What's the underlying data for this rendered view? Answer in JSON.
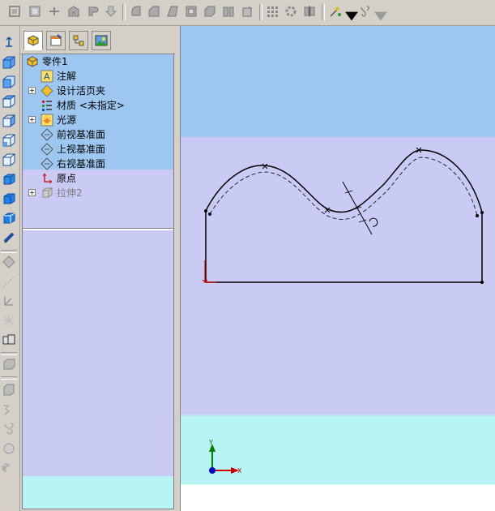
{
  "toolbar": {
    "icons": [
      "sketch-icon",
      "smart-dimension-icon",
      "revolve-icon",
      "sweep-icon",
      "loft-icon",
      "rib-icon",
      "fillet-icon",
      "chamfer-icon",
      "draft-icon",
      "shell-icon",
      "dome-icon",
      "wrap-icon",
      "mirror-icon",
      "linear-pattern-icon",
      "circular-pattern-icon",
      "mirror-feature-icon",
      "reference-geometry-icon",
      "curves-icon"
    ]
  },
  "left_toolbar": {
    "icons": [
      "normal-to-icon",
      "isometric-view-icon",
      "front-view-icon",
      "top-view-icon",
      "right-view-icon",
      "back-view-icon",
      "bottom-view-icon",
      "wireframe-icon",
      "shaded-icon",
      "shaded-edges-icon",
      "section-view-icon",
      "line-icon",
      "point-icon",
      "plane-icon",
      "axis-icon",
      "coordinate-icon",
      "extrude-icon",
      "cut-icon",
      "sweep-cut-icon",
      "loft-cut-icon",
      "helix-icon"
    ]
  },
  "feature_manager": {
    "tabs": [
      "feature-tree-tab",
      "property-manager-tab",
      "configuration-manager-tab",
      "display-manager-tab"
    ],
    "tree": {
      "root": {
        "label": "零件1"
      },
      "items": [
        {
          "label": "注解",
          "icon": "annotation-icon",
          "expandable": false
        },
        {
          "label": "设计活页夹",
          "icon": "design-binder-icon",
          "expandable": true
        },
        {
          "label": "材质 <未指定>",
          "icon": "material-icon",
          "expandable": false
        },
        {
          "label": "光源",
          "icon": "lights-icon",
          "expandable": true
        },
        {
          "label": "前视基准面",
          "icon": "plane-icon",
          "expandable": false
        },
        {
          "label": "上视基准面",
          "icon": "plane-icon",
          "expandable": false
        },
        {
          "label": "右视基准面",
          "icon": "plane-icon",
          "expandable": false
        },
        {
          "label": "原点",
          "icon": "origin-icon",
          "expandable": false
        },
        {
          "label": "拉伸2",
          "icon": "extrude-feature-icon",
          "expandable": true,
          "disabled": true
        }
      ]
    }
  },
  "viewport": {
    "triad": {
      "x_label": "X",
      "y_label": "Y"
    },
    "colors": {
      "sketch_line": "#000000",
      "origin": "#cc0000",
      "triad_x": "#cc0000",
      "triad_y": "#008000",
      "triad_z": "#0000cc"
    }
  }
}
